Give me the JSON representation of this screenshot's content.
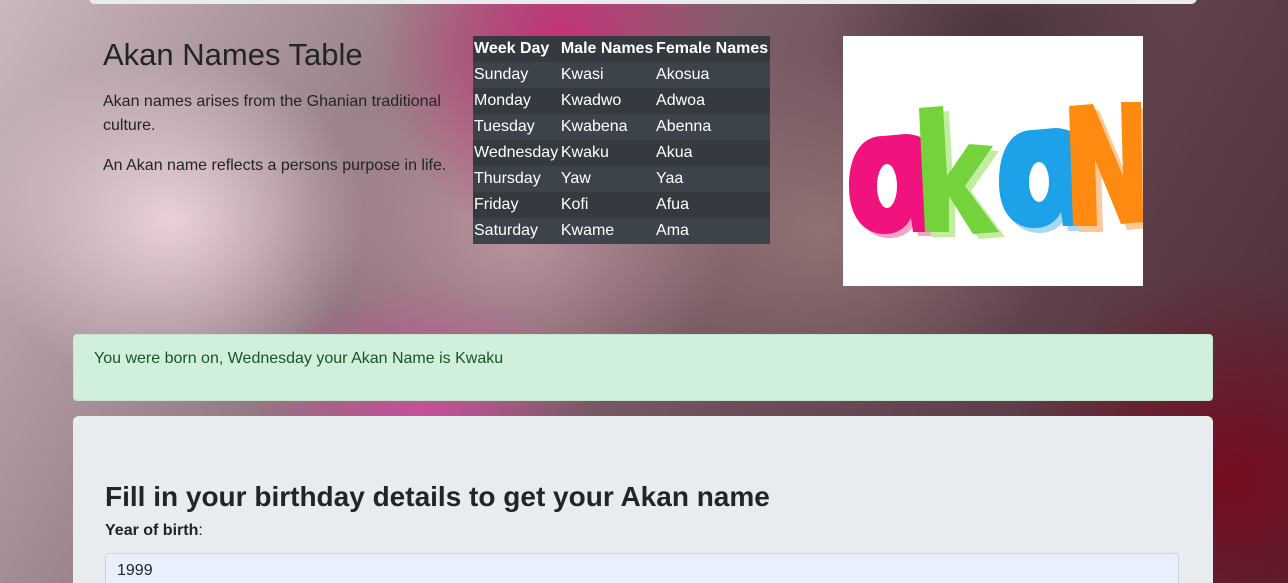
{
  "intro": {
    "title": "Akan Names Table",
    "paragraph_1": "Akan names arises from the Ghanian traditional culture.",
    "paragraph_2": "An Akan name reflects a persons purpose in life."
  },
  "names_table": {
    "headers": [
      "Week Day",
      "Male Names",
      "Female Names"
    ],
    "rows": [
      [
        "Sunday",
        "Kwasi",
        "Akosua"
      ],
      [
        "Monday",
        "Kwadwo",
        "Adwoa"
      ],
      [
        "Tuesday",
        "Kwabena",
        "Abenna"
      ],
      [
        "Wednesday",
        "Kwaku",
        "Akua"
      ],
      [
        "Thursday",
        "Yaw",
        "Yaa"
      ],
      [
        "Friday",
        "Kofi",
        "Afua"
      ],
      [
        "Saturday",
        "Kwame",
        "Ama"
      ]
    ]
  },
  "logo": {
    "text": "akan",
    "letter_colors": [
      "#f0137e",
      "#74d23c",
      "#1da1e8",
      "#ff8a12"
    ]
  },
  "result_alert": {
    "text": "You were born on, Wednesday your Akan Name is Kwaku"
  },
  "form": {
    "heading": "Fill in your birthday details to get your Akan name",
    "year_label": "Year of birth",
    "year_label_suffix": ":",
    "year_value": "1999"
  }
}
